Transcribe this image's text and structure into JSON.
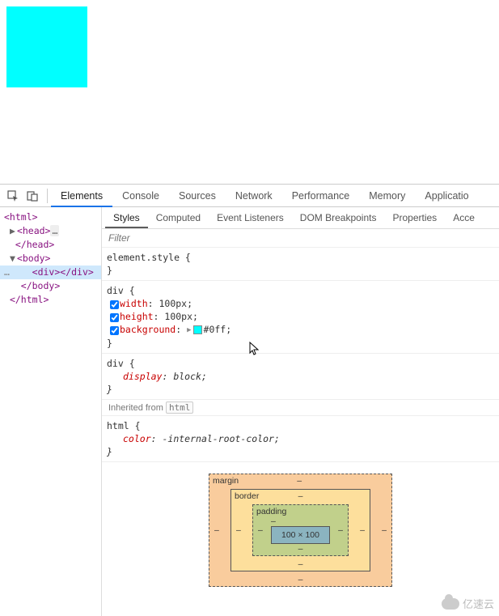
{
  "tabs": {
    "elements": "Elements",
    "console": "Console",
    "sources": "Sources",
    "network": "Network",
    "performance": "Performance",
    "memory": "Memory",
    "application": "Applicatio"
  },
  "sub_tabs": {
    "styles": "Styles",
    "computed": "Computed",
    "event_listeners": "Event Listeners",
    "dom_breakpoints": "DOM Breakpoints",
    "properties": "Properties",
    "accessibility": "Acce"
  },
  "filter_placeholder": "Filter",
  "dom": {
    "html_open": "<html>",
    "head_open": "<head>",
    "head_ellipsis": "…",
    "head_close": "</head>",
    "body_open": "<body>",
    "div_open": "<div>",
    "div_close": "</div>",
    "body_close": "</body>",
    "html_close": "</html>",
    "sel_dots": "…"
  },
  "rules": {
    "r1_sel": "element.style {",
    "close": "}",
    "r2_sel": "div {",
    "r2_p1_name": "width",
    "r2_p1_val": "100px",
    "r2_p2_name": "height",
    "r2_p2_val": "100px",
    "r2_p3_name": "background",
    "r2_p3_val": "#0ff",
    "r3_sel": "div {",
    "r3_p1_name": "display",
    "r3_p1_val": "block",
    "inherit_label": "Inherited from",
    "inherit_tag": "html",
    "r4_sel": "html {",
    "r4_p1_name": "color",
    "r4_p1_val": "-internal-root-color"
  },
  "boxmodel": {
    "margin_label": "margin",
    "border_label": "border",
    "padding_label": "padding",
    "dash": "‒",
    "content": "100 × 100"
  },
  "watermark": "亿速云",
  "colors": {
    "cyan": "#00ffff"
  }
}
